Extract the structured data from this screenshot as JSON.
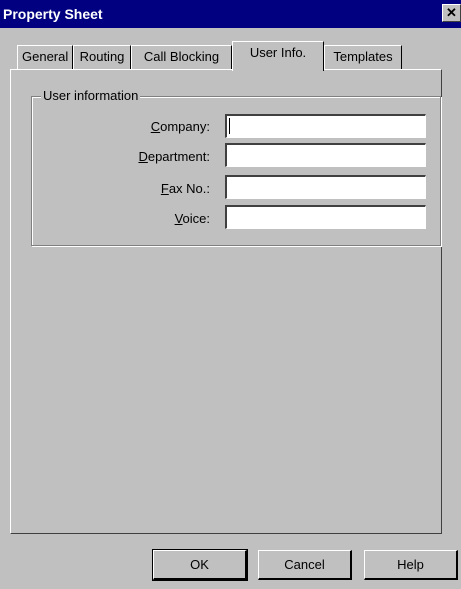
{
  "window": {
    "title": "Property Sheet",
    "close_glyph": "✕"
  },
  "tabs": [
    {
      "label": "General"
    },
    {
      "label": "Routing"
    },
    {
      "label": "Call Blocking"
    },
    {
      "label": "User Info."
    },
    {
      "label": "Templates"
    }
  ],
  "active_tab": "User Info.",
  "group": {
    "legend": "User information"
  },
  "fields": {
    "company": {
      "label_mnemonic": "C",
      "label_rest": "ompany:",
      "value": ""
    },
    "department": {
      "label_mnemonic": "D",
      "label_rest": "epartment:",
      "value": ""
    },
    "fax": {
      "label_mnemonic": "F",
      "label_rest": "ax No.:",
      "value": ""
    },
    "voice": {
      "label_mnemonic": "V",
      "label_rest": "oice:",
      "value": ""
    }
  },
  "buttons": {
    "ok": "OK",
    "cancel": "Cancel",
    "help": "Help"
  }
}
